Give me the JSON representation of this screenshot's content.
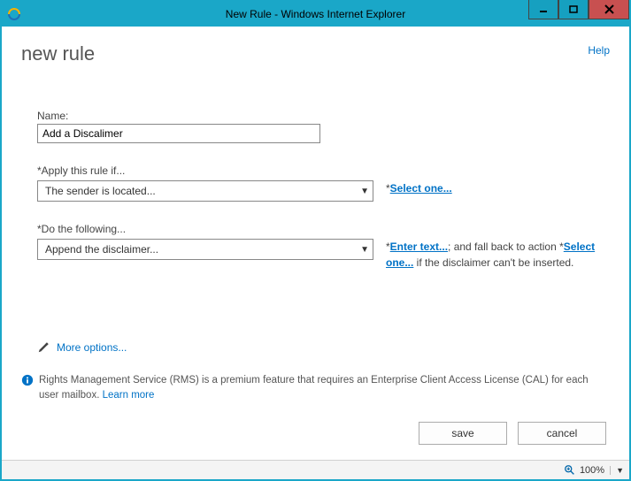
{
  "window": {
    "title": "New Rule - Windows Internet Explorer"
  },
  "header": {
    "help": "Help",
    "page_title": "new rule"
  },
  "form": {
    "name_label": "Name:",
    "name_value": "Add a Discalimer",
    "condition_label": "*Apply this rule if...",
    "condition_value": "The sender is located...",
    "condition_side_prefix": "*",
    "condition_side_link": "Select one...",
    "action_label": "*Do the following...",
    "action_value": "Append the disclaimer...",
    "action_side_prefix1": "*",
    "action_side_link1": "Enter text...",
    "action_side_mid": "; and fall back to action *",
    "action_side_link2": "Select one...",
    "action_side_suffix": " if the disclaimer can't be inserted."
  },
  "more_options": "More options...",
  "info": {
    "text": "Rights Management Service (RMS) is a premium feature that requires an Enterprise Client Access License (CAL) for each user mailbox. ",
    "learn": "Learn more"
  },
  "buttons": {
    "save": "save",
    "cancel": "cancel"
  },
  "status": {
    "zoom": "100%"
  }
}
